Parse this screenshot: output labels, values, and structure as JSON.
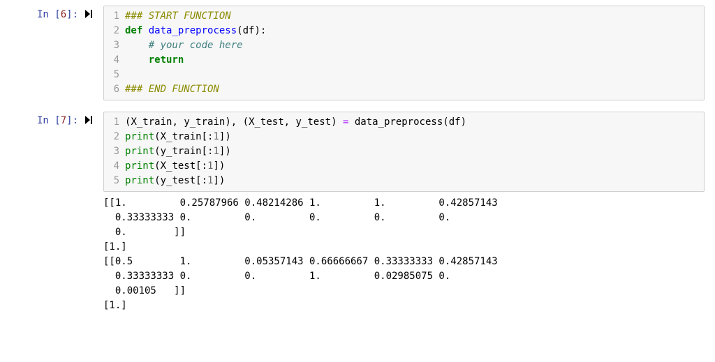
{
  "cells": {
    "cell6": {
      "prompt_label": "In [",
      "prompt_num": "6",
      "prompt_close": "]:",
      "lines": {
        "l1_gutter": "1",
        "l1_comment": "### START FUNCTION",
        "l2_gutter": "2",
        "l2_def": "def",
        "l2_space1": " ",
        "l2_func": "data_preprocess",
        "l2_paren1": "(",
        "l2_arg": "df",
        "l2_paren2": ")",
        "l2_colon": ":",
        "l3_gutter": "3",
        "l3_indent": "    ",
        "l3_comment": "# your code here",
        "l4_gutter": "4",
        "l4_indent": "    ",
        "l4_return": "return",
        "l5_gutter": "5",
        "l5_blank": "",
        "l6_gutter": "6",
        "l6_comment": "### END FUNCTION"
      }
    },
    "cell7": {
      "prompt_label": "In [",
      "prompt_num": "7",
      "prompt_close": "]:",
      "lines": {
        "l1_gutter": "1",
        "l1_p1": "(",
        "l1_xtrain": "X_train",
        "l1_c1": ", ",
        "l1_ytrain": "y_train",
        "l1_p2": ")",
        "l1_c2": ", ",
        "l1_p3": "(",
        "l1_xtest": "X_test",
        "l1_c3": ", ",
        "l1_ytest": "y_test",
        "l1_p4": ")",
        "l1_sp": " ",
        "l1_eq": "=",
        "l1_sp2": " ",
        "l1_func": "data_preprocess",
        "l1_p5": "(",
        "l1_df": "df",
        "l1_p6": ")",
        "l2_gutter": "2",
        "l2_print": "print",
        "l2_p1": "(",
        "l2_var": "X_train",
        "l2_br1": "[",
        "l2_colon": ":",
        "l2_num": "1",
        "l2_br2": "]",
        "l2_p2": ")",
        "l3_gutter": "3",
        "l3_print": "print",
        "l3_p1": "(",
        "l3_var": "y_train",
        "l3_br1": "[",
        "l3_colon": ":",
        "l3_num": "1",
        "l3_br2": "]",
        "l3_p2": ")",
        "l4_gutter": "4",
        "l4_print": "print",
        "l4_p1": "(",
        "l4_var": "X_test",
        "l4_br1": "[",
        "l4_colon": ":",
        "l4_num": "1",
        "l4_br2": "]",
        "l4_p2": ")",
        "l5_gutter": "5",
        "l5_print": "print",
        "l5_p1": "(",
        "l5_var": "y_test",
        "l5_br1": "[",
        "l5_colon": ":",
        "l5_num": "1",
        "l5_br2": "]",
        "l5_p2": ")"
      },
      "output": "[[1.         0.25787966 0.48214286 1.         1.         0.42857143\n  0.33333333 0.         0.         0.         0.         0.\n  0.        ]]\n[1.]\n[[0.5        1.         0.05357143 0.66666667 0.33333333 0.42857143\n  0.33333333 0.         0.         1.         0.02985075 0.\n  0.00105   ]]\n[1.]"
    }
  }
}
